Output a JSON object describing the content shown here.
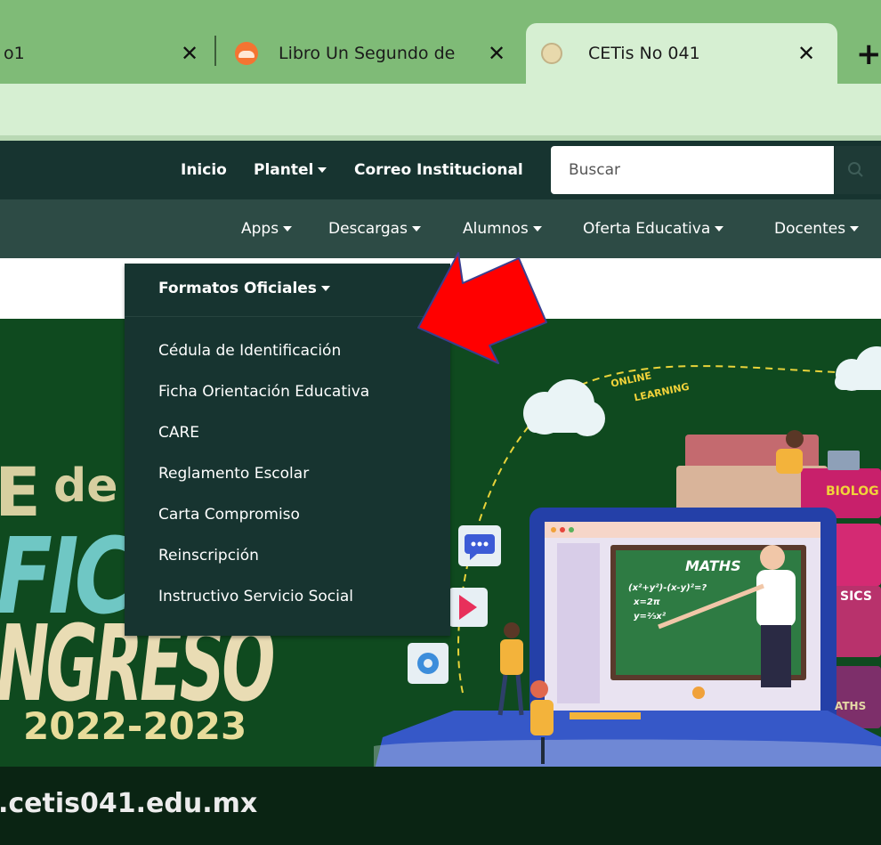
{
  "browser": {
    "tabs": [
      {
        "title": "o1",
        "active": false
      },
      {
        "title": "Libro Un Segundo de",
        "active": false
      },
      {
        "title": "CETis No 041",
        "active": true
      }
    ],
    "close_glyph": "✕",
    "new_tab_glyph": "+"
  },
  "navbar": {
    "items": [
      {
        "label": "Inicio",
        "has_caret": false
      },
      {
        "label": "Plantel",
        "has_caret": true
      },
      {
        "label": "Correo Institucional",
        "has_caret": false
      }
    ],
    "search_placeholder": "Buscar",
    "search_icon": "magnifier-icon"
  },
  "subnav": {
    "items": [
      {
        "label": "Apps"
      },
      {
        "label": "Descargas"
      },
      {
        "label": "Alumnos"
      },
      {
        "label": "Oferta Educativa"
      },
      {
        "label": "Docentes"
      }
    ]
  },
  "dropdown": {
    "header": "Formatos Oficiales",
    "items": [
      "Cédula de Identificación",
      "Ficha Orientación Educativa",
      "CARE",
      "Reglamento Escolar",
      "Carta Compromiso",
      "Reinscripción",
      "Instructivo Servicio Social"
    ]
  },
  "hero": {
    "line_de": "de",
    "line_fic": "FIC",
    "line_ingreso": "NGRESO",
    "years": "2022-2023",
    "url": ".cetis041.edu.mx",
    "online_label": "ONLINE LEARNING",
    "online_l1": "ONLINE",
    "online_l2": "LEARNING",
    "maths_label": "MATHS",
    "formula_1": "(x²+y²)-(x-y)²=?",
    "formula_2": "x=2π",
    "formula_3": "y=⅔x²",
    "book_biology": "BIOLOG",
    "book_physics": "SICS",
    "book_maths": "ATHS"
  },
  "colors": {
    "tabbar": "#7fbb77",
    "active_tab": "#d6efd2",
    "nav_dark": "#173430",
    "nav_secondary": "#2d4b45",
    "hero_green": "#0f4a1f",
    "arrow_red": "#ff0000",
    "arrow_outline": "#3b3f8f"
  }
}
